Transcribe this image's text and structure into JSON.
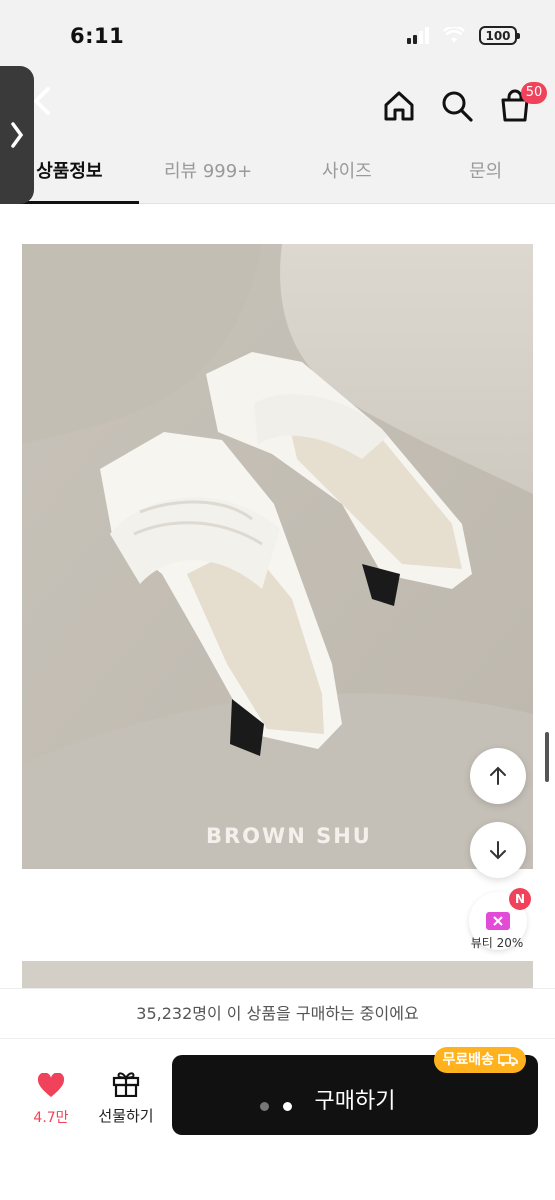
{
  "status_bar": {
    "time": "6:11",
    "battery": "100"
  },
  "header": {
    "cart_count": "50"
  },
  "tabs": [
    {
      "label": "상품정보",
      "active": true
    },
    {
      "label": "리뷰 999+",
      "active": false
    },
    {
      "label": "사이즈",
      "active": false
    },
    {
      "label": "문의",
      "active": false
    }
  ],
  "product": {
    "image_watermark": "BROWN SHU"
  },
  "promo": {
    "badge": "N",
    "label": "뷰티 20%"
  },
  "buying_notice": "35,232명이 이 상품을 구매하는 중이에요",
  "bottom_bar": {
    "like_count": "4.7만",
    "gift_label": "선물하기",
    "buy_label": "구매하기",
    "shipping_badge": "무료배송"
  },
  "colors": {
    "accent": "#f0435b",
    "ship_badge": "#ffb21e",
    "buy_button": "#111111"
  }
}
